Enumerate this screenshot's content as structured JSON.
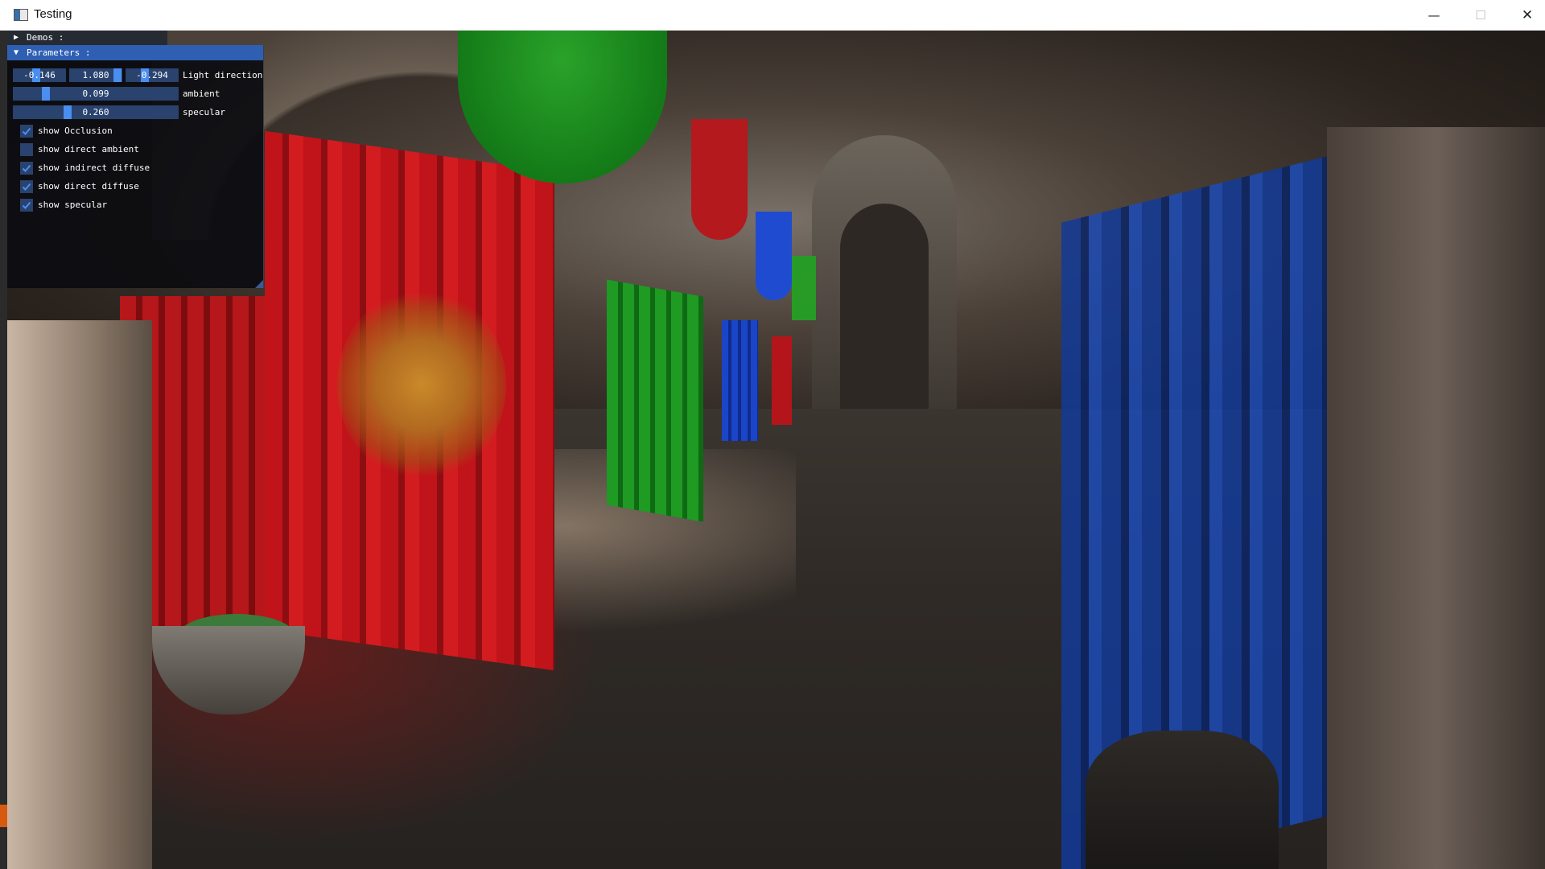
{
  "window": {
    "title": "Testing",
    "minimize": "—",
    "maximize": "☐",
    "close": "✕",
    "icon": "app-window-icon"
  },
  "menu": {
    "demos_label": "Demos :",
    "parameters_label": "Parameters :"
  },
  "light_direction": {
    "x": "-0.146",
    "y": "1.080",
    "z": "-0.294",
    "label": "Light direction"
  },
  "ambient": {
    "value": "0.099",
    "fraction": 0.099,
    "label": "ambient"
  },
  "specular": {
    "value": "0.260",
    "fraction": 0.26,
    "label": "specular"
  },
  "toggles": [
    {
      "label": "show Occlusion",
      "checked": true
    },
    {
      "label": "show direct ambient",
      "checked": false
    },
    {
      "label": "show indirect diffuse",
      "checked": true
    },
    {
      "label": "show direct diffuse",
      "checked": true
    },
    {
      "label": "show specular",
      "checked": true
    }
  ],
  "colors": {
    "accent": "#2f5fb3",
    "frame_bg": "#29426e",
    "slider_grab": "#4a8ef0",
    "check": "#4a8ef0"
  }
}
